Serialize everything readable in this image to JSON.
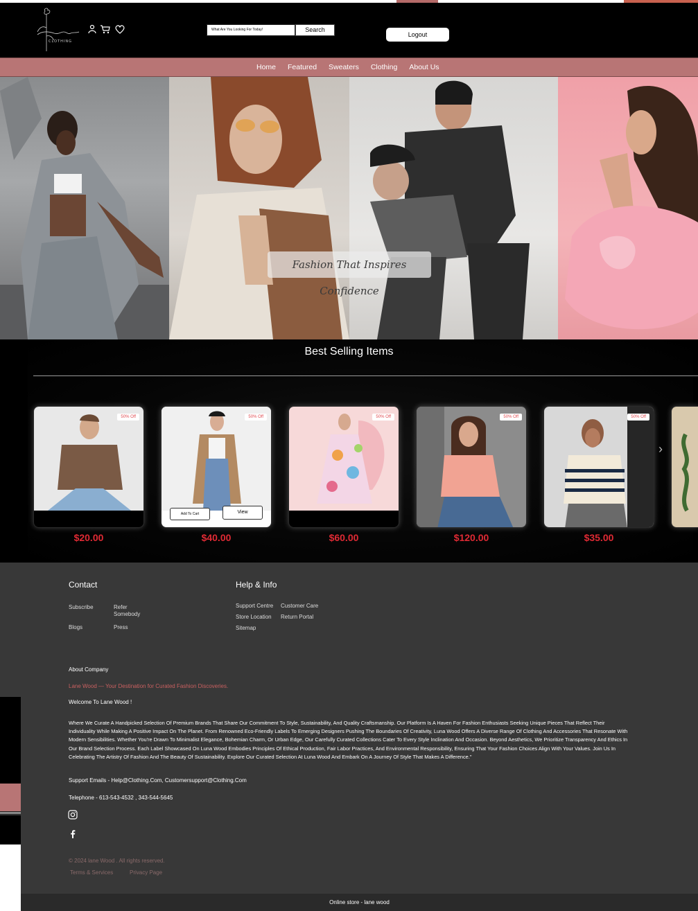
{
  "header": {
    "search_placeholder": "What Are You Looking For Today!",
    "search_button": "Search",
    "logout_button": "Logout",
    "logo_text": "lanewood clothing",
    "icons": [
      "user-icon",
      "cart-icon",
      "heart-icon"
    ]
  },
  "nav": {
    "items": [
      "Home",
      "Featured",
      "Sweaters",
      "Clothing",
      "About Us"
    ]
  },
  "hero": {
    "tagline": "Fashion That Inspires Confidence"
  },
  "best_selling": {
    "title": "Best Selling Items",
    "cards": [
      {
        "badge": "50% Off",
        "price": "$20.00"
      },
      {
        "badge": "50% Off",
        "price": "$40.00",
        "add_to_cart": "Add To Cart",
        "view": "View"
      },
      {
        "badge": "50% Off",
        "price": "$60.00"
      },
      {
        "badge": "50% Off",
        "price": "$120.00"
      },
      {
        "badge": "50% Off",
        "price": "$35.00"
      }
    ]
  },
  "footer": {
    "contact_heading": "Contact",
    "help_heading": "Help & Info",
    "contact_links": [
      "Subscribe",
      "Refer Somebody",
      "Blogs",
      "Press"
    ],
    "help_links": [
      "Support Centre",
      "Customer Care",
      "Store Location",
      "Return Portal",
      "Sitemap"
    ],
    "about_heading": "About Company",
    "tagline": "Lane Wood — Your Destination for Curated Fashion Discoveries.",
    "welcome": "Welcome To Lane Wood !",
    "paragraph": "Where We Curate A Handpicked Selection Of Premium Brands That Share Our Commitment To Style, Sustainability, And Quality Craftsmanship. Our Platform Is A Haven For Fashion Enthusiasts Seeking Unique Pieces That Reflect Their Individuality While Making A Positive Impact On The Planet. From Renowned Eco-Friendly Labels To Emerging Designers Pushing The Boundaries Of Creativity, Luna Wood Offers A Diverse Range Of Clothing And Accessories That Resonate With Modern Sensibilities. Whether You're Drawn To Minimalist Elegance, Bohemian Charm, Or Urban Edge, Our Carefully Curated Collections Cater To Every Style Inclination And Occasion. Beyond Aesthetics, We Prioritize Transparency And Ethics In Our Brand Selection Process. Each Label Showcased On Luna Wood Embodies Principles Of Ethical Production, Fair Labor Practices, And Environmental Responsibility, Ensuring That Your Fashion Choices Align With Your Values. Join Us In Celebrating The Artistry Of Fashion And The Beauty Of Sustainability. Explore Our Curated Selection At Luna Wood And Embark On A Journey Of Style That Makes A Difference.\"",
    "support_emails": "Support Emails - Help@Clothing.Com, Customersupport@Clothing.Com",
    "telephone": "Telephone - 613-543-4532 , 343-544-5645",
    "copyright": "© 2024 lane Wood . All rights reserved.",
    "terms": "Terms & Services",
    "privacy": "Privacy Page",
    "bottom_bar": "Online store - lane wood"
  }
}
